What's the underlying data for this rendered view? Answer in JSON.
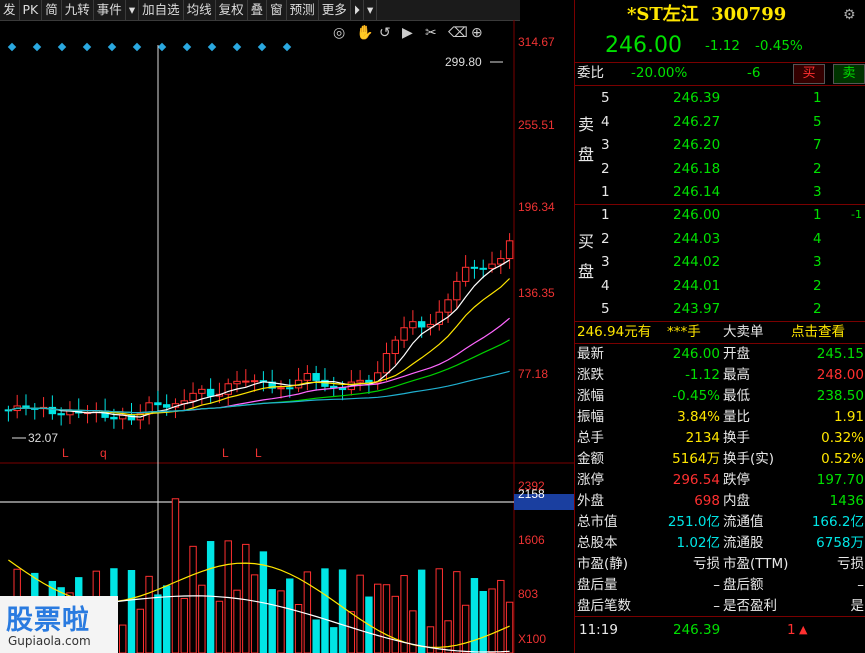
{
  "toolbar": [
    "发",
    "PK",
    "简",
    "九转",
    "事件",
    "▾",
    "加自选",
    "均线",
    "复权",
    "叠",
    "窗",
    "预测",
    "更多",
    "⏵",
    "▾"
  ],
  "chart_tools": [
    "eye-icon",
    "hand-icon",
    "replay-icon",
    "cut-icon",
    "trash-icon",
    "zoom-in-icon",
    "zoom-out-icon"
  ],
  "price_axis": [
    "314.67",
    "255.51",
    "196.34",
    "136.35",
    "77.18"
  ],
  "high_label": "299.80",
  "low_label": "32.07",
  "event_markers": [
    "L",
    "q",
    "L",
    "L"
  ],
  "volume_axis": [
    "2392",
    "2158",
    "1606",
    "803",
    "X100"
  ],
  "stock": {
    "name": "*ST左江",
    "code": "300799",
    "price": "246.00",
    "change": "-1.12",
    "pct": "-0.45%"
  },
  "weibi": {
    "label": "委比",
    "pct": "-20.00%",
    "diff": "-6",
    "sell_btn": "买",
    "buy_btn": "卖"
  },
  "asks": {
    "label": [
      "卖",
      "盘"
    ],
    "rows": [
      {
        "lvl": "5",
        "price": "246.39",
        "vol": "1"
      },
      {
        "lvl": "4",
        "price": "246.27",
        "vol": "5"
      },
      {
        "lvl": "3",
        "price": "246.20",
        "vol": "7"
      },
      {
        "lvl": "2",
        "price": "246.18",
        "vol": "2"
      },
      {
        "lvl": "1",
        "price": "246.14",
        "vol": "3"
      }
    ]
  },
  "bids": {
    "label": [
      "买",
      "盘"
    ],
    "rows": [
      {
        "lvl": "1",
        "price": "246.00",
        "vol": "1",
        "extra": "-1"
      },
      {
        "lvl": "2",
        "price": "244.03",
        "vol": "4",
        "extra": ""
      },
      {
        "lvl": "3",
        "price": "244.02",
        "vol": "3",
        "extra": ""
      },
      {
        "lvl": "4",
        "price": "244.01",
        "vol": "2",
        "extra": ""
      },
      {
        "lvl": "5",
        "price": "243.97",
        "vol": "2",
        "extra": ""
      }
    ]
  },
  "bigorder": {
    "amount": "246.94元有",
    "hands": "***手",
    "title": "大卖单",
    "link": "点击查看"
  },
  "stats": [
    {
      "k1": "最新",
      "v1": "246.00",
      "c1": "g",
      "k2": "开盘",
      "v2": "245.15",
      "c2": "g"
    },
    {
      "k1": "涨跌",
      "v1": "-1.12",
      "c1": "g",
      "k2": "最高",
      "v2": "248.00",
      "c2": "r"
    },
    {
      "k1": "涨幅",
      "v1": "-0.45%",
      "c1": "g",
      "k2": "最低",
      "v2": "238.50",
      "c2": "g"
    },
    {
      "k1": "振幅",
      "v1": "3.84%",
      "c1": "y",
      "k2": "量比",
      "v2": "1.91",
      "c2": "y"
    },
    {
      "k1": "总手",
      "v1": "2134",
      "c1": "y",
      "k2": "换手",
      "v2": "0.32%",
      "c2": "y"
    },
    {
      "k1": "金额",
      "v1": "5164万",
      "c1": "y",
      "k2": "换手(实)",
      "v2": "0.52%",
      "c2": "y"
    },
    {
      "k1": "涨停",
      "v1": "296.54",
      "c1": "r",
      "k2": "跌停",
      "v2": "197.70",
      "c2": "g"
    },
    {
      "k1": "外盘",
      "v1": "698",
      "c1": "r",
      "k2": "内盘",
      "v2": "1436",
      "c2": "g"
    },
    {
      "k1": "总市值",
      "v1": "251.0亿",
      "c1": "c",
      "k2": "流通值",
      "v2": "166.2亿",
      "c2": "c"
    },
    {
      "k1": "总股本",
      "v1": "1.02亿",
      "c1": "c",
      "k2": "流通股",
      "v2": "6758万",
      "c2": "c"
    },
    {
      "k1": "市盈(静)",
      "v1": "亏损",
      "c1": "w",
      "k2": "市盈(TTM)",
      "v2": "亏损",
      "c2": "w"
    },
    {
      "k1": "盘后量",
      "v1": "–",
      "c1": "w",
      "k2": "盘后额",
      "v2": "–",
      "c2": "w"
    },
    {
      "k1": "盘后笔数",
      "v1": "–",
      "c1": "w",
      "k2": "是否盈利",
      "v2": "是",
      "c2": "w"
    }
  ],
  "tick": {
    "time": "11:19",
    "price": "246.39",
    "vol": "1"
  },
  "watermark": {
    "text": "股票啦",
    "sub": "Gupiaola.com"
  },
  "colors": {
    "up": "#ff3030",
    "down": "#00e5e5",
    "ma5": "#ffffff",
    "ma10": "#ffe600",
    "ma20": "#ff66ff",
    "ma30": "#00d000",
    "ma60": "#20b0d0"
  }
}
